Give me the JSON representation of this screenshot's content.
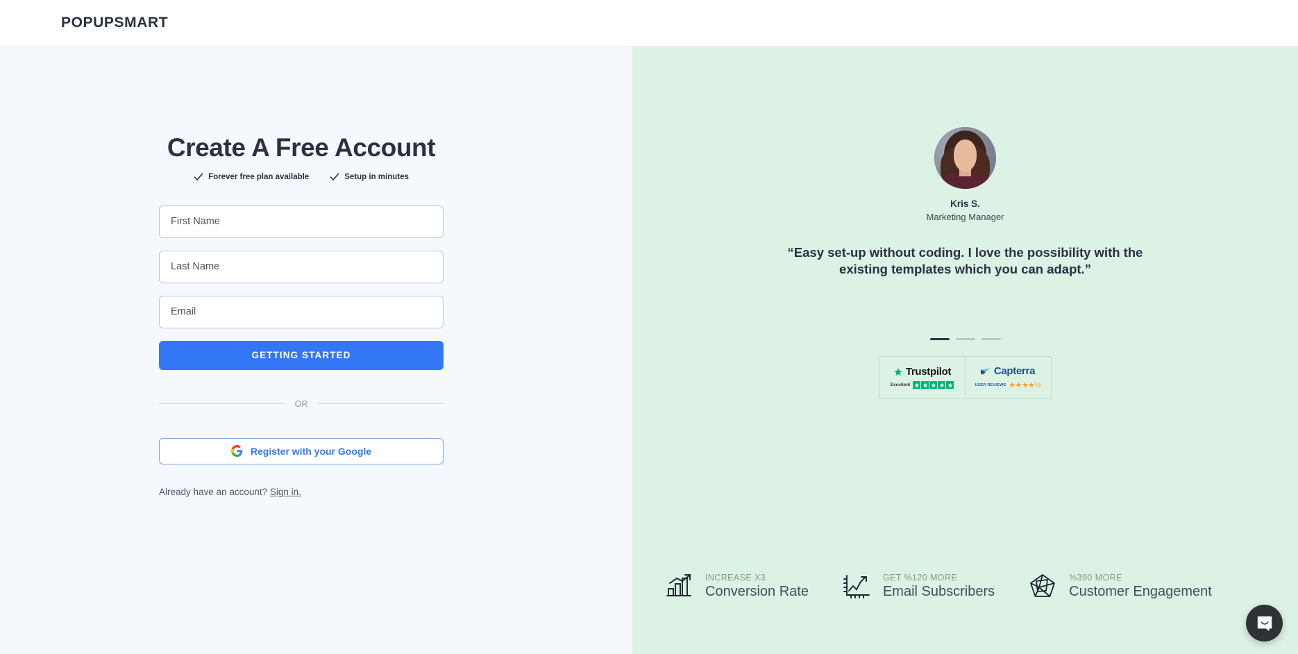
{
  "header": {
    "logo_text": "POPUPSMART"
  },
  "signup": {
    "title": "Create A Free Account",
    "perks": [
      {
        "icon": "check-icon",
        "label": "Forever free plan available"
      },
      {
        "icon": "check-icon",
        "label": "Setup in minutes"
      }
    ],
    "fields": [
      {
        "name": "first-name",
        "placeholder": "First Name",
        "value": ""
      },
      {
        "name": "last-name",
        "placeholder": "Last Name",
        "value": ""
      },
      {
        "name": "email",
        "placeholder": "Email",
        "value": ""
      }
    ],
    "submit_label": "GETTING STARTED",
    "divider_label": "OR",
    "google_button_label": "Register with your Google",
    "google_icon": "google-g-icon",
    "signin_prompt": "Already have an account?",
    "signin_link": "Sign in."
  },
  "testimonial": {
    "avatar_icon": "avatar",
    "name": "Kris S.",
    "role": "Marketing Manager",
    "quote": "“Easy set-up without coding. I love the possibility with the existing templates which you can adapt.”",
    "carousel": {
      "total": 3,
      "active_index": 0
    }
  },
  "badges": [
    {
      "name": "Trustpilot",
      "rating_label": "Excellent",
      "stars": 5,
      "star_color": "#00b67a"
    },
    {
      "name": "Capterra",
      "rating_label": "USER REVIEWS",
      "stars": "★★★★½",
      "star_color": "#ff9d28"
    }
  ],
  "stats": [
    {
      "icon": "bar-chart-icon",
      "kicker": "INCREASE X3",
      "value": "Conversion Rate"
    },
    {
      "icon": "line-chart-icon",
      "kicker": "GET %120 MORE",
      "value": "Email Subscribers"
    },
    {
      "icon": "network-pentagon-icon",
      "kicker": "%390 MORE",
      "value": "Customer Engagement"
    }
  ],
  "chat": {
    "icon": "chat-bubble-icon"
  },
  "colors": {
    "brand_dark": "#2b3043",
    "accent_blue": "#3377f6",
    "panel_left_bg": "#f5f8fd",
    "panel_right_bg": "#dcf2e4",
    "trustpilot_green": "#00b67a",
    "capterra_orange": "#ff9d28"
  }
}
